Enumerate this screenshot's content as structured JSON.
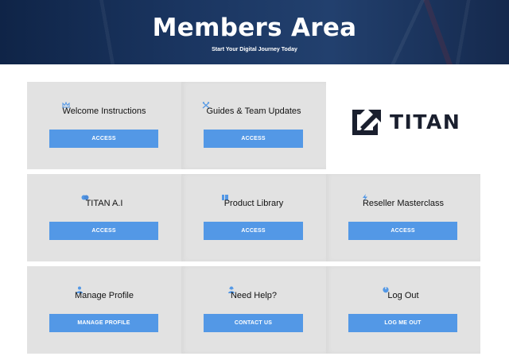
{
  "header": {
    "title": "Members Area",
    "subtitle": "Start Your Digital Journey Today"
  },
  "brand": {
    "logo_text": "TITAN",
    "color": "#1a1f2e"
  },
  "colors": {
    "accent": "#5398e6",
    "card_bg": "#e2e2e2",
    "header_bg": "#15294d"
  },
  "cards": [
    {
      "title": "Welcome Instructions",
      "button": "ACCESS",
      "icon": "crown-icon"
    },
    {
      "title": "Guides & Team Updates",
      "button": "ACCESS",
      "icon": "tools-icon"
    },
    {
      "title": "TITAN A.I",
      "button": "ACCESS",
      "icon": "brain-icon"
    },
    {
      "title": "Product Library",
      "button": "ACCESS",
      "icon": "book-icon"
    },
    {
      "title": "Reseller Masterclass",
      "button": "ACCESS",
      "icon": "lightning-icon"
    },
    {
      "title": "Manage Profile",
      "button": "MANAGE PROFILE",
      "icon": "user-icon"
    },
    {
      "title": "Need Help?",
      "button": "CONTACT US",
      "icon": "support-icon"
    },
    {
      "title": "Log Out",
      "button": "LOG ME OUT",
      "icon": "logout-icon"
    }
  ]
}
